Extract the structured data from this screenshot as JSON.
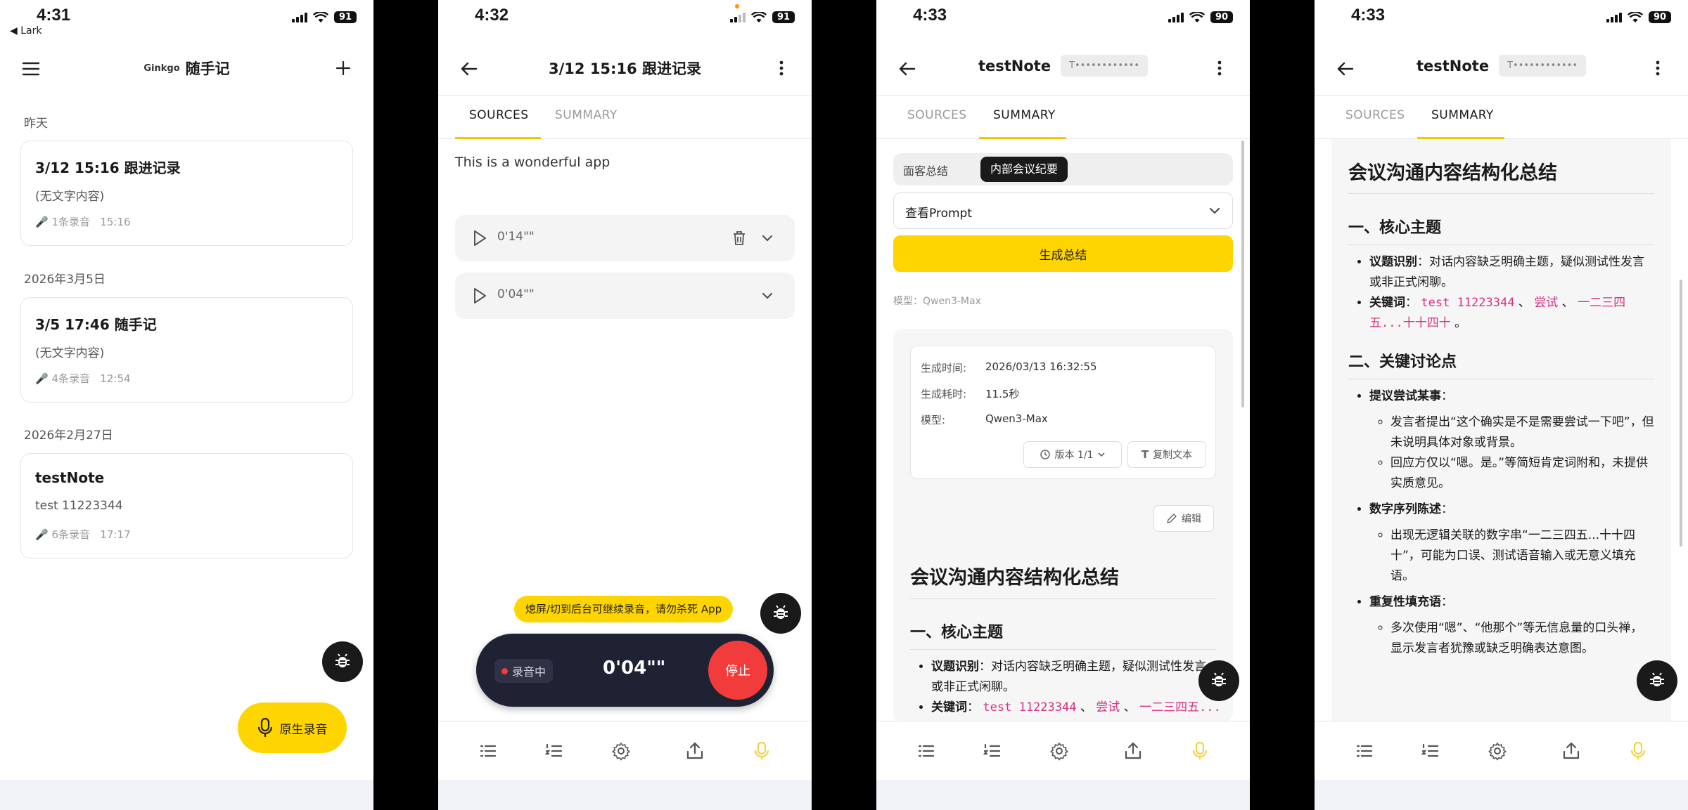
{
  "colors": {
    "accent_yellow": "#FFD500",
    "dark": "#1A1A1A",
    "record_red": "#F23B3B",
    "recorder_bg": "#1E2233",
    "inline_code": "#D63384"
  },
  "screen1": {
    "time": "4:31",
    "back_app": "◀ Lark",
    "battery": "91",
    "brand": "Ginkgo",
    "title": "随手记",
    "groups": [
      {
        "label": "昨天",
        "card": {
          "title": "3/12 15:16 跟进记录",
          "subtitle": "(无文字内容)",
          "meta_count": "1条录音",
          "meta_time": "15:16"
        }
      },
      {
        "label": "2026年3月5日",
        "card": {
          "title": "3/5 17:46 随手记",
          "subtitle": "(无文字内容)",
          "meta_count": "4条录音",
          "meta_time": "12:54"
        }
      },
      {
        "label": "2026年2月27日",
        "card": {
          "title": "testNote",
          "subtitle": "test 11223344",
          "meta_count": "6条录音",
          "meta_time": "17:17"
        }
      }
    ],
    "record_button": "原生录音"
  },
  "screen2": {
    "time": "4:32",
    "battery": "91",
    "title": "3/12 15:16 跟进记录",
    "tabs": [
      "SOURCES",
      "SUMMARY"
    ],
    "source_text": "This is a wonderful app",
    "audio": [
      {
        "duration": "0'14\"\""
      },
      {
        "duration": "0'04\"\""
      }
    ],
    "hint": "熄屏/切到后台可继续录音，请勿杀死 App",
    "recording_label": "录音中",
    "recording_timer": "0'04\"\"",
    "stop_label": "停止"
  },
  "screen3": {
    "time": "4:33",
    "battery": "90",
    "title": "testNote",
    "tag": "T••••••••••••",
    "tabs": [
      "SOURCES",
      "SUMMARY"
    ],
    "segments": [
      "面客总结",
      "内部会议纪要"
    ],
    "prompt_select": "查看Prompt",
    "generate_button": "生成总结",
    "model_line": "模型：Qwen3-Max",
    "info": {
      "time_label": "生成时间:",
      "time_value": "2026/03/13 16:32:55",
      "duration_label": "生成耗时:",
      "duration_value": "11.5秒",
      "model_label": "模型:",
      "model_value": "Qwen3-Max"
    },
    "version_button": "版本 1/1",
    "copy_button": "复制文本",
    "edit_button": "编辑",
    "doc_title": "会议沟通内容结构化总结",
    "h2_1": "一、核心主题",
    "item1_label": "议题识别",
    "item1_text": "：对话内容缺乏明确主题，疑似测试性发言或非正式闲聊。",
    "item2_label": "关键词",
    "item2_sep1": "： ",
    "kw1": "test 11223344",
    "sep": " 、 ",
    "kw2": "尝试",
    "kw3": "一二三四五..."
  },
  "screen4": {
    "time": "4:33",
    "battery": "90",
    "title": "testNote",
    "tag": "T••••••••••••",
    "tabs": [
      "SOURCES",
      "SUMMARY"
    ],
    "doc_title": "会议沟通内容结构化总结",
    "h2_1": "一、核心主题",
    "b1_label": "议题识别",
    "b1_text": "：对话内容缺乏明确主题，疑似测试性发言或非正式闲聊。",
    "b2_label": "关键词",
    "b2_colon": "： ",
    "kw1": "test 11223344",
    "sep": " 、 ",
    "kw2": "尝试",
    "kw3": "一二三四五...十十四十",
    "end": " 。",
    "h2_2": "二、关键讨论点",
    "p1_label": "提议尝试某事",
    "p1_colon": "：",
    "p1_sub1": "发言者提出“这个确实是不是需要尝试一下吧”，但未说明具体对象或背景。",
    "p1_sub2": "回应方仅以“嗯。是。”等简短肯定词附和，未提供实质意见。",
    "p2_label": "数字序列陈述",
    "p2_colon": "：",
    "p2_sub1": "出现无逻辑关联的数字串“一二三四五...十十四十”，可能为口误、测试语音输入或无意义填充语。",
    "p3_label": "重复性填充语",
    "p3_colon": "：",
    "p3_sub1": "多次使用“嗯”、“他那个”等无信息量的口头禅，显示发言者犹豫或缺乏明确表达意图。"
  }
}
